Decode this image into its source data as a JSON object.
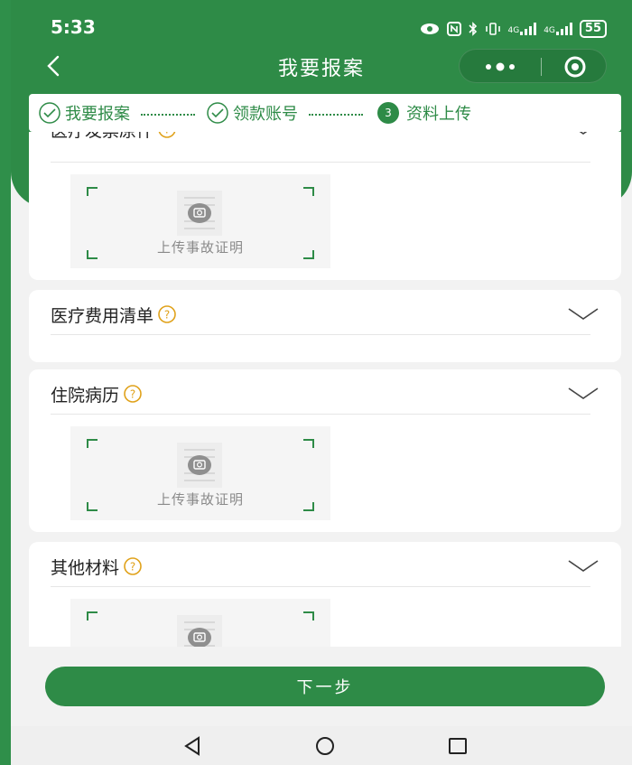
{
  "status_bar": {
    "time": "5:33",
    "icons": [
      "eye-icon",
      "nfc-icon",
      "bluetooth-icon",
      "vibrate-icon",
      "signal-4g-icon",
      "signal-4g-icon"
    ],
    "net_label_1": "4G",
    "net_label_2": "4G",
    "battery": "55"
  },
  "nav": {
    "title": "我要报案",
    "back_icon": "chevron-left-icon",
    "more_icon": "more-dots-icon",
    "close_icon": "target-circle-icon"
  },
  "steps": [
    {
      "label": "我要报案",
      "state": "done",
      "icon": "check-circle-icon"
    },
    {
      "label": "领款账号",
      "state": "done",
      "icon": "check-circle-icon"
    },
    {
      "label": "资料上传",
      "state": "current",
      "number": "3"
    }
  ],
  "sections": [
    {
      "title": "医疗发票原件",
      "expanded": true,
      "upload_label": "上传事故证明"
    },
    {
      "title": "医疗费用清单",
      "expanded": false
    },
    {
      "title": "住院病历",
      "expanded": true,
      "upload_label": "上传事故证明"
    },
    {
      "title": "其他材料",
      "expanded": true,
      "upload_label": ""
    }
  ],
  "next_button": "下一步",
  "android_nav": {
    "back": "triangle-back-icon",
    "home": "circle-home-icon",
    "recent": "square-recent-icon"
  },
  "colors": {
    "primary": "#2e8b47",
    "header": "#2e8b47",
    "background": "#f2f2f2",
    "upload_bg": "#f5f5f5"
  }
}
